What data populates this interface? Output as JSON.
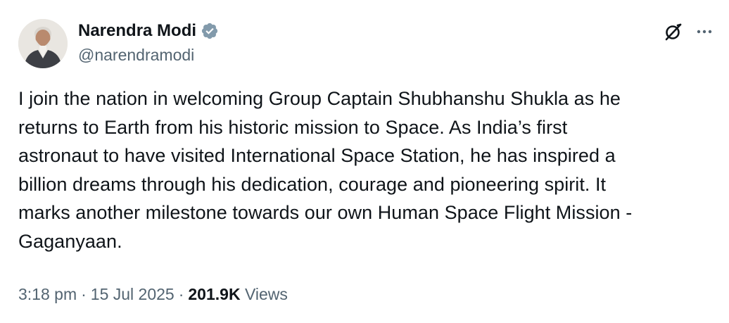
{
  "author": {
    "name": "Narendra Modi",
    "handle": "@narendramodi",
    "verified": true,
    "verified_color": "#829aab",
    "avatar_icon": "profile-photo"
  },
  "actions": {
    "grok_icon": "grok-icon",
    "more_icon": "more-icon"
  },
  "tweet": {
    "lines": [
      "I join the nation in welcoming Group Captain Shubhanshu Shukla as he",
      "returns to Earth from his historic mission to Space. As India’s first",
      "astronaut to have visited International Space Station, he has inspired a",
      "billion dreams through his dedication, courage and pioneering spirit. It",
      "marks another milestone towards our own Human Space Flight Mission -",
      "Gaganyaan."
    ]
  },
  "meta": {
    "time": "3:18 pm",
    "separator": "·",
    "date": "15 Jul 2025",
    "views_count": "201.9K",
    "views_label": "Views"
  },
  "colors": {
    "text_primary": "#0f1419",
    "text_secondary": "#536471",
    "background": "#ffffff"
  }
}
